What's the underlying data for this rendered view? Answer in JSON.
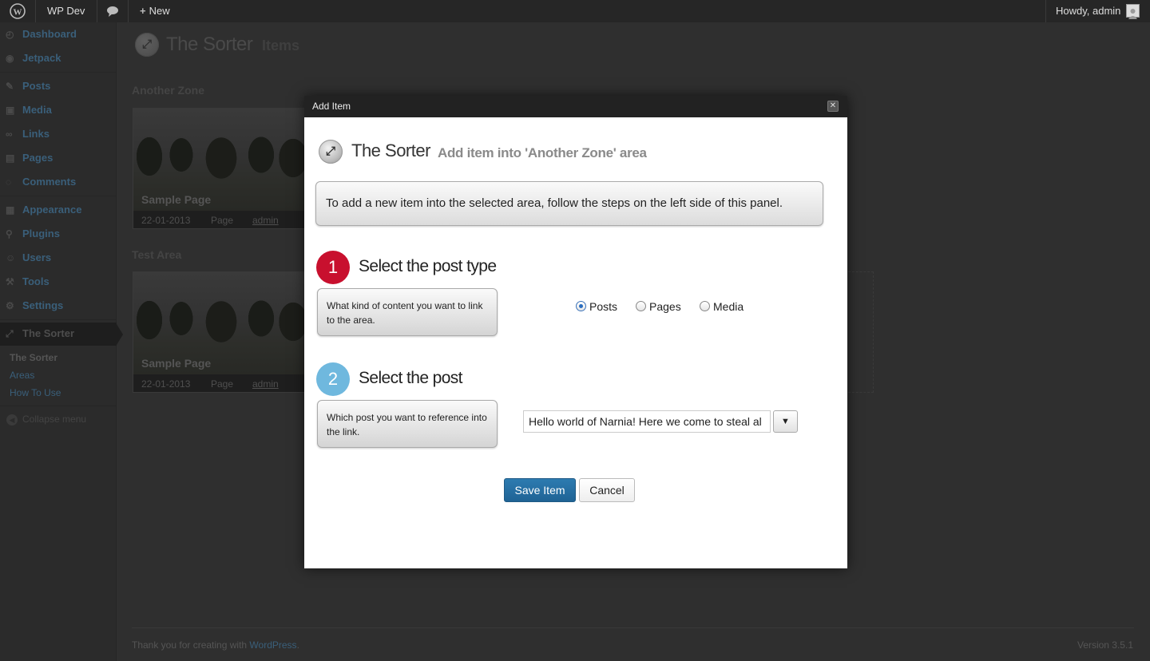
{
  "adminbar": {
    "site_name": "WP Dev",
    "new_label": "New",
    "howdy": "Howdy, admin"
  },
  "sidebar": {
    "items": [
      {
        "label": "Dashboard",
        "icon": "dashboard-icon"
      },
      {
        "label": "Jetpack",
        "icon": "jetpack-icon"
      },
      {
        "label": "Posts",
        "icon": "posts-icon"
      },
      {
        "label": "Media",
        "icon": "media-icon"
      },
      {
        "label": "Links",
        "icon": "links-icon"
      },
      {
        "label": "Pages",
        "icon": "pages-icon"
      },
      {
        "label": "Comments",
        "icon": "comments-icon"
      },
      {
        "label": "Appearance",
        "icon": "appearance-icon"
      },
      {
        "label": "Plugins",
        "icon": "plugins-icon"
      },
      {
        "label": "Users",
        "icon": "users-icon"
      },
      {
        "label": "Tools",
        "icon": "tools-icon"
      },
      {
        "label": "Settings",
        "icon": "settings-icon"
      },
      {
        "label": "The Sorter",
        "icon": "sorter-icon"
      }
    ],
    "submenu": [
      "The Sorter",
      "Areas",
      "How To Use"
    ],
    "collapse": "Collapse menu"
  },
  "page": {
    "title": "The Sorter",
    "subtitle": "Items",
    "zones": [
      {
        "title": "Another Zone",
        "card": {
          "title": "Sample Page",
          "date": "22-01-2013",
          "type": "Page",
          "author": "admin"
        }
      },
      {
        "title": "Test Area",
        "card": {
          "title": "Sample Page",
          "date": "22-01-2013",
          "type": "Page",
          "author": "admin"
        }
      }
    ]
  },
  "modal": {
    "title": "Add Item",
    "brand": "The Sorter",
    "subtitle": "Add item into 'Another Zone' area",
    "info": "To add a new item into the selected area, follow the steps on the left side of this panel.",
    "step1": {
      "number": "1",
      "title": "Select the post type",
      "desc": "What kind of content you want to link to the area.",
      "color": "#c8102e",
      "options": [
        {
          "label": "Posts",
          "checked": true
        },
        {
          "label": "Pages",
          "checked": false
        },
        {
          "label": "Media",
          "checked": false
        }
      ]
    },
    "step2": {
      "number": "2",
      "title": "Select the post",
      "desc": "Which post you want to reference into the link.",
      "color": "#6fb8de",
      "selected_post": "Hello world of Narnia! Here we come to steal al"
    },
    "save_label": "Save Item",
    "cancel_label": "Cancel"
  },
  "footer": {
    "thanks_prefix": "Thank you for creating with",
    "thanks_link": "WordPress",
    "thanks_suffix": ".",
    "version": "Version 3.5.1"
  }
}
